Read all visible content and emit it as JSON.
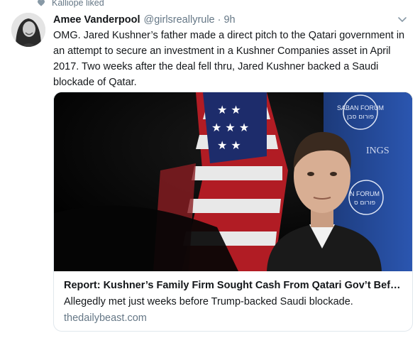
{
  "activity": {
    "liked_by": "Kalliope liked",
    "icon": "heart-icon"
  },
  "tweet": {
    "author_name": "Amee Vanderpool",
    "author_handle": "@girlsreallyrule",
    "separator": "·",
    "time": "9h",
    "text": "OMG. Jared Kushner’s father made a direct pitch to the Qatari government in an attempt to secure an investment in a Kushner Companies asset in April 2017. Two weeks after the deal fell thru, Jared Kushner backed a Saudi blockade of Qatar.",
    "menu_icon": "chevron-down-icon"
  },
  "card": {
    "title": "Report: Kushner’s Family Firm Sought Cash From Qatari Gov’t Before Saudi Blockade",
    "description": "Allegedly met just weeks before Trump-backed Saudi blockade.",
    "domain": "thedailybeast.com",
    "image_banner_top": "SABAN FORUM",
    "image_banner_top_hebrew": "פורום סבן",
    "image_banner_mid": "INGS",
    "image_banner_bottom": "N FORUM",
    "image_banner_bottom_hebrew": "פורום ס"
  },
  "colors": {
    "text": "#14171a",
    "muted": "#657786",
    "border": "#e1e8ed"
  }
}
